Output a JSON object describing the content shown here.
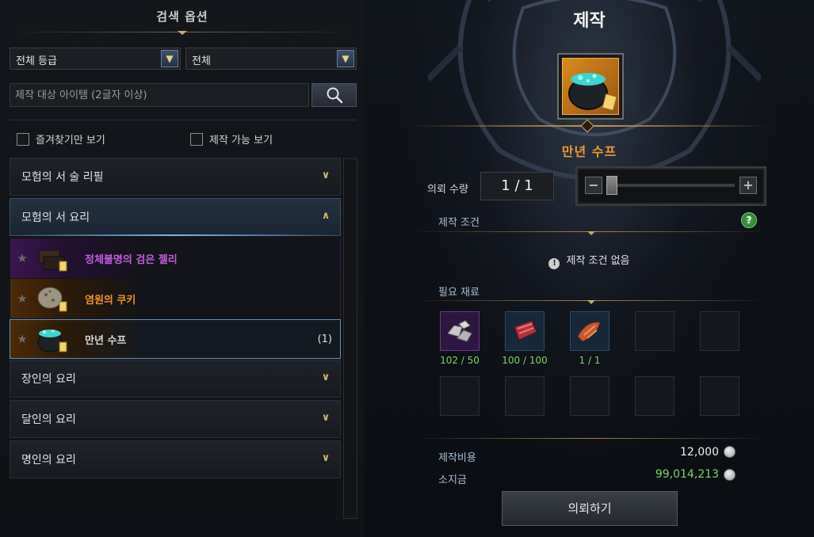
{
  "left": {
    "title": "검색 옵션",
    "grade_select": "전체 등급",
    "type_select": "전체",
    "search_placeholder": "제작 대상 아이템 (2글자 이상)",
    "favorites_label": "즐겨찾기만 보기",
    "craftable_label": "제작 가능 보기",
    "categories": [
      {
        "label": "모험의 서 술 리필",
        "expanded": false
      },
      {
        "label": "모험의 서 요리",
        "expanded": true,
        "items": [
          {
            "name": "정체불명의 검은 젤리",
            "rarity": "purple",
            "count": ""
          },
          {
            "name": "염원의 쿠키",
            "rarity": "orange",
            "count": ""
          },
          {
            "name": "만년 수프",
            "rarity": "orange",
            "count": "(1)",
            "selected": true
          }
        ]
      },
      {
        "label": "장인의 요리",
        "expanded": false
      },
      {
        "label": "달인의 요리",
        "expanded": false
      },
      {
        "label": "명인의 요리",
        "expanded": false
      }
    ]
  },
  "right": {
    "title": "제작",
    "item_name": "만년 수프",
    "qty_label": "의뢰 수량",
    "qty_value": "1 / 1",
    "slider_fraction": 0.0,
    "conditions_label": "제작 조건",
    "no_conditions": "제작 조건 없음",
    "materials_label": "필요 재료",
    "materials": [
      {
        "icon": "ore-icon",
        "count": "102 / 50",
        "rarity": "purple"
      },
      {
        "icon": "meat-icon",
        "count": "100 / 100",
        "rarity": "blue"
      },
      {
        "icon": "fish-icon",
        "count": "1 / 1",
        "rarity": "blue"
      }
    ],
    "cost_label": "제작비용",
    "cost_value": "12,000",
    "owned_label": "소지금",
    "owned_value": "99,014,213",
    "request_button": "의뢰하기"
  },
  "colors": {
    "accent_gold": "#c9a968",
    "item_orange": "#f29a2e",
    "item_purple": "#c85ae0",
    "count_green": "#7fd36a"
  }
}
